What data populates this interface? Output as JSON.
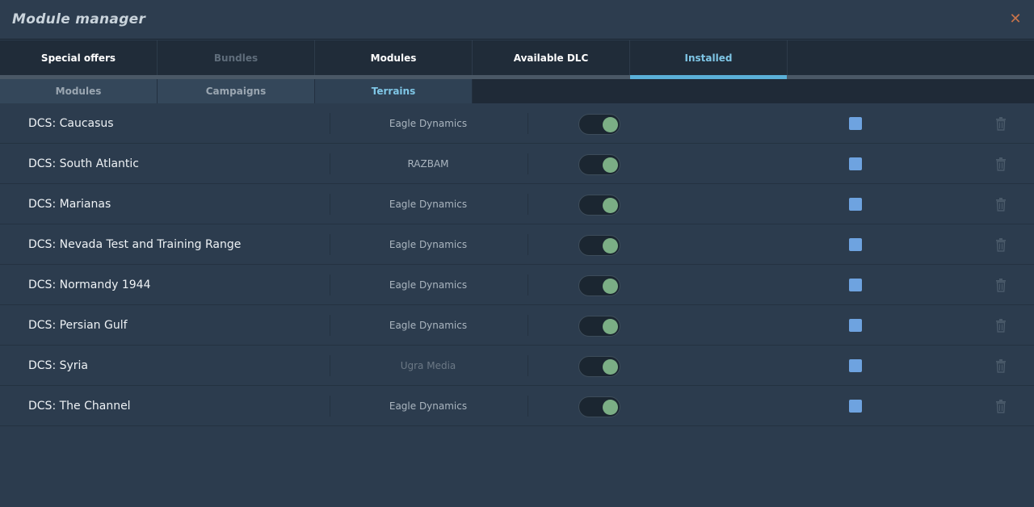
{
  "window": {
    "title": "Module manager",
    "close_icon": "close-icon"
  },
  "main_tabs": [
    {
      "label": "Special offers",
      "state": "normal"
    },
    {
      "label": "Bundles",
      "state": "disabled"
    },
    {
      "label": "Modules",
      "state": "normal"
    },
    {
      "label": "Available DLC",
      "state": "normal"
    },
    {
      "label": "Installed",
      "state": "active"
    }
  ],
  "sub_tabs": [
    {
      "label": "Modules",
      "state": "normal"
    },
    {
      "label": "Campaigns",
      "state": "normal"
    },
    {
      "label": "Terrains",
      "state": "active"
    }
  ],
  "terrains": [
    {
      "name": "DCS: Caucasus",
      "developer": "Eagle Dynamics",
      "enabled": true,
      "checked": true
    },
    {
      "name": "DCS: South Atlantic",
      "developer": "RAZBAM",
      "enabled": true,
      "checked": true
    },
    {
      "name": "DCS: Marianas",
      "developer": "Eagle Dynamics",
      "enabled": true,
      "checked": true
    },
    {
      "name": "DCS: Nevada Test and Training Range",
      "developer": "Eagle Dynamics",
      "enabled": true,
      "checked": true
    },
    {
      "name": "DCS: Normandy 1944",
      "developer": "Eagle Dynamics",
      "enabled": true,
      "checked": true
    },
    {
      "name": "DCS: Persian Gulf",
      "developer": "Eagle Dynamics",
      "enabled": true,
      "checked": true
    },
    {
      "name": "DCS: Syria",
      "developer": "Ugra Media",
      "developer_dim": true,
      "enabled": true,
      "checked": true
    },
    {
      "name": "DCS: The Channel",
      "developer": "Eagle Dynamics",
      "enabled": true,
      "checked": true
    }
  ],
  "colors": {
    "accent": "#5ab0d8",
    "toggle_on": "#7bae85",
    "checkbox": "#6ea3e0",
    "close": "#c8734a"
  }
}
